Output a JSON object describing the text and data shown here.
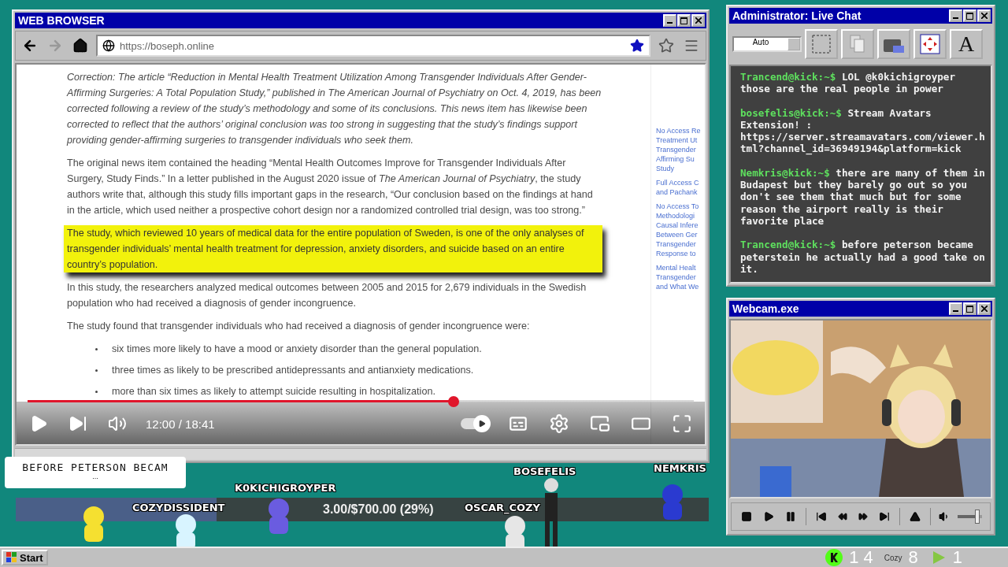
{
  "browser": {
    "title": "WEB BROWSER",
    "url": "https://boseph.online",
    "bookmarked": true,
    "article": {
      "correction": "Correction: The article “Reduction in Mental Health Treatment Utilization Among Transgender Individuals After Gender-Affirming Surgeries: A Total Population Study,” published in The American Journal of Psychiatry on Oct. 4, 2019, has been corrected following a review of the study’s methodology and some of its conclusions. This news item has likewise been corrected to reflect that the authors’ original conclusion was too strong in suggesting that the study’s findings support providing gender-affirming surgeries to transgender individuals who seek them.",
      "paragraphs": [
        {
          "text": "The original news item contained the heading “Mental Health Outcomes Improve for Transgender Individuals After Surgery, Study Finds.”  In a letter published in the August 2020 issue of *The American Journal of Psychiatry*, the study authors write that, although this study fills important gaps in the research, “Our conclusion based on the findings at hand in the article, which used neither a prospective cohort design nor a randomized controlled trial design, was too strong.”",
          "highlighted": false
        },
        {
          "text": "The study, which reviewed 10 years of medical data for the entire population of Sweden, is one of the only analyses of transgender individuals’ mental health treatment for depression, anxiety disorders, and suicide based on an entire country’s population.",
          "highlighted": true
        },
        {
          "text": "In this study, the researchers analyzed medical outcomes between 2005 and 2015 for 2,679 individuals in the Swedish population who had received a diagnosis of gender incongruence.",
          "highlighted": false
        },
        {
          "text": "The study found that transgender individuals who had received a diagnosis of gender incongruence were:",
          "highlighted": false
        }
      ],
      "bullets": [
        "six times more likely to have a mood or anxiety disorder than the general population.",
        "three times as likely to be prescribed antidepressants and antianxiety medications.",
        "more than six times as likely to attempt suicide resulting in hospitalization."
      ],
      "sidebar_links": [
        [
          "No Access Re",
          "Treatment Ut",
          "Transgender",
          "Affirming Su",
          "Study"
        ],
        [
          "Full Access C",
          "and Pachank"
        ],
        [
          "No Access To",
          "Methodologi",
          "Causal Infere",
          "Between Ger",
          "Transgender",
          "Response to"
        ],
        [
          "Mental Healt",
          "Transgender",
          "and What We"
        ]
      ]
    },
    "player": {
      "time": "12:00 / 18:41",
      "level": 0.64,
      "autoplay": true
    }
  },
  "chat": {
    "title": "Administrator: Live Chat",
    "font_select": "Auto",
    "font_button": "A",
    "messages": [
      {
        "user": "Trancend@kick:~$",
        "text": "LOL @k0kichigroyper those are the real people in power"
      },
      {
        "user": "bosefelis@kick:~$",
        "text": "Stream Avatars Extension! : https://server.streamavatars.com/viewer.html?channel_id=36949194&platform=kick"
      },
      {
        "user": "Nemkris@kick:~$",
        "text": "there are many of them in Budapest but they barely go out so you don't see them that much but for some reason the airport really is their favorite place"
      },
      {
        "user": "Trancend@kick:~$",
        "text": "before peterson became peterstein he actually had a good take on it."
      }
    ]
  },
  "webcam": {
    "title": "Webcam.exe",
    "volume": {
      "level": 0.8
    }
  },
  "stream": {
    "goal": {
      "text": "3.00/$700.00 (29%)",
      "level": 0.29
    },
    "bubble": {
      "text": "BEFORE PETERSON BECAM",
      "more": "..."
    },
    "avatars": [
      {
        "name": "COZYDISSIDENT"
      },
      {
        "name": "K0KICHIGROYPER"
      },
      {
        "name": "BOSEFELIS"
      },
      {
        "name": "OSCAR_COZY"
      },
      {
        "name": "NEMKRIS"
      }
    ]
  },
  "taskbar": {
    "start": "Start",
    "counters": [
      {
        "kind": "kick",
        "count": "14"
      },
      {
        "kind": "cozy",
        "label": "Cozy",
        "count": "8"
      },
      {
        "kind": "rumble",
        "count": "1"
      }
    ]
  }
}
